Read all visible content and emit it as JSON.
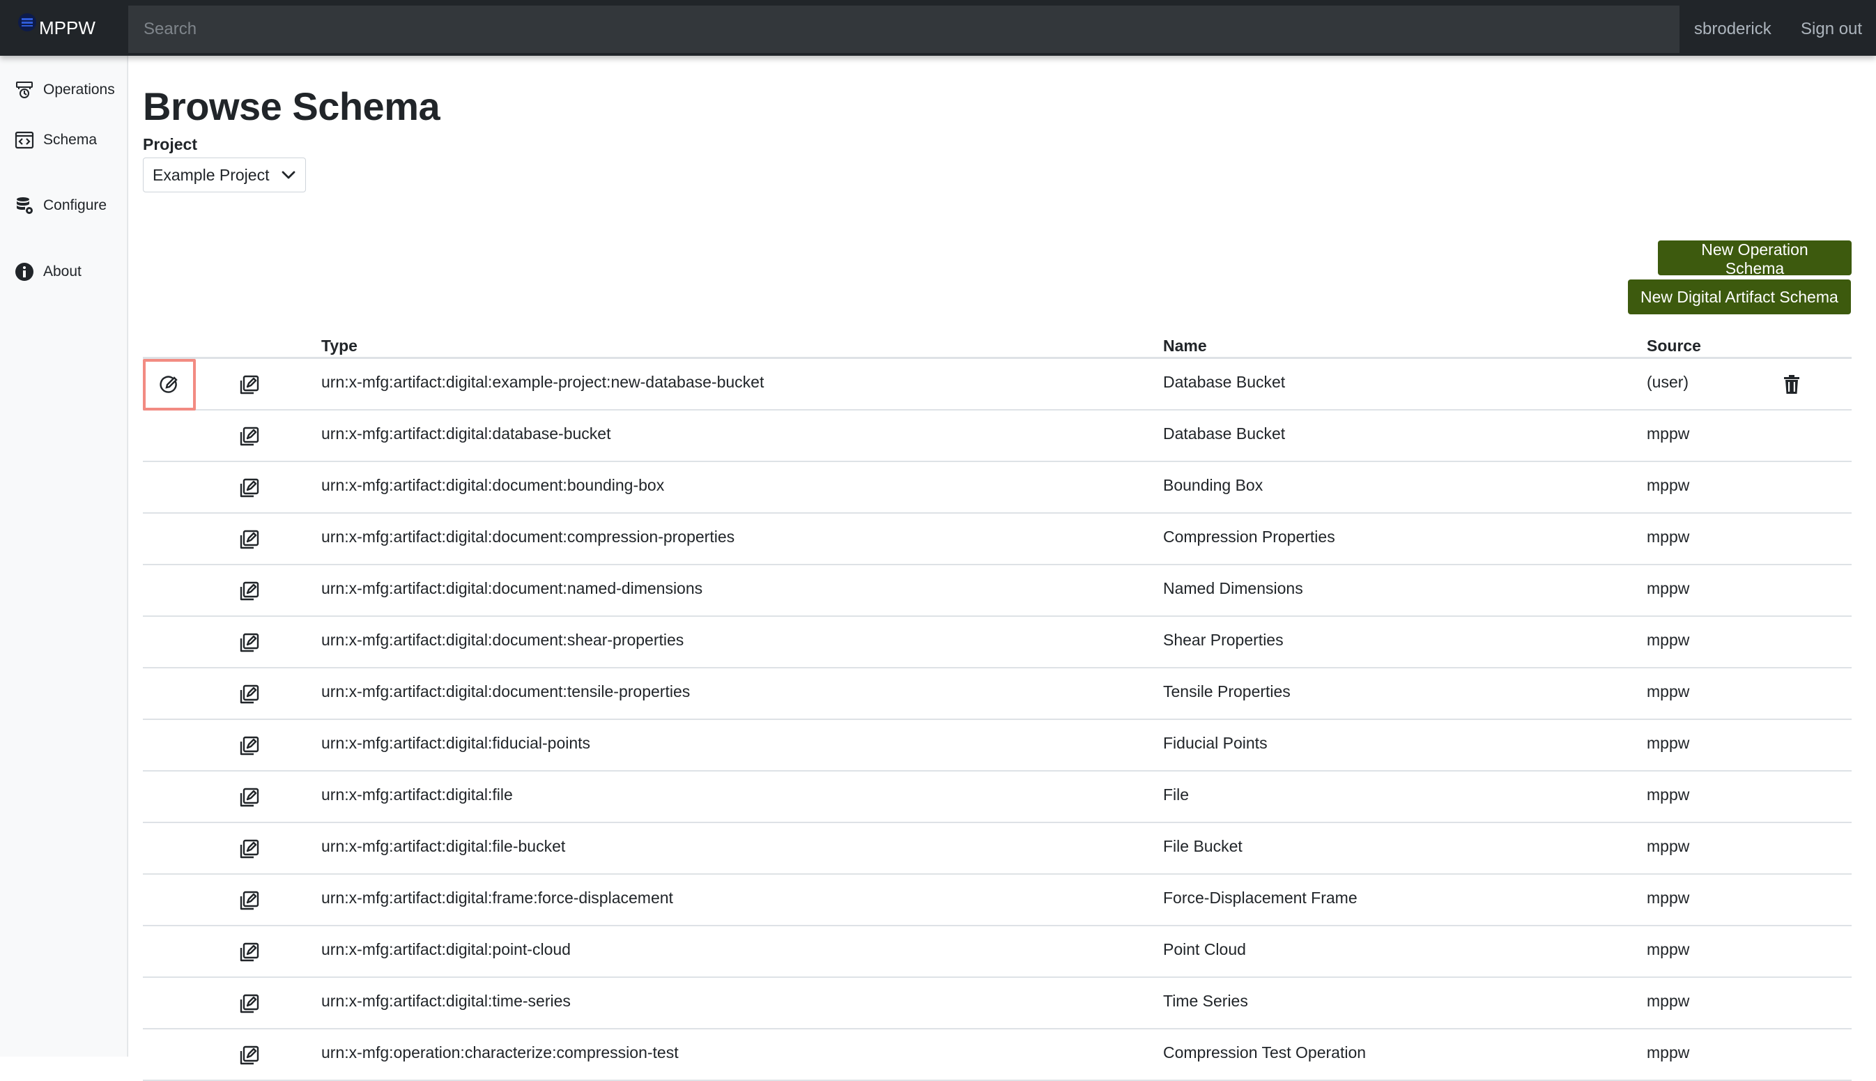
{
  "navbar": {
    "brand": "MPPW",
    "search_placeholder": "Search",
    "username": "sbroderick",
    "signout": "Sign out"
  },
  "sidebar": {
    "items": [
      {
        "label": "Operations",
        "icon": "operations-icon"
      },
      {
        "label": "Schema",
        "icon": "schema-icon"
      },
      {
        "label": "Configure",
        "icon": "configure-icon"
      },
      {
        "label": "About",
        "icon": "info-icon"
      }
    ]
  },
  "main": {
    "title": "Browse Schema",
    "project_label": "Project",
    "project_value": "Example Project",
    "new_operation_button": "New Operation Schema",
    "new_artifact_button": "New Digital Artifact Schema"
  },
  "table": {
    "headers": {
      "type": "Type",
      "name": "Name",
      "source": "Source"
    },
    "rows": [
      {
        "type": "urn:x-mfg:artifact:digital:example-project:new-database-bucket",
        "name": "Database Bucket",
        "source": "(user)",
        "editable": true
      },
      {
        "type": "urn:x-mfg:artifact:digital:database-bucket",
        "name": "Database Bucket",
        "source": "mppw"
      },
      {
        "type": "urn:x-mfg:artifact:digital:document:bounding-box",
        "name": "Bounding Box",
        "source": "mppw"
      },
      {
        "type": "urn:x-mfg:artifact:digital:document:compression-properties",
        "name": "Compression Properties",
        "source": "mppw"
      },
      {
        "type": "urn:x-mfg:artifact:digital:document:named-dimensions",
        "name": "Named Dimensions",
        "source": "mppw"
      },
      {
        "type": "urn:x-mfg:artifact:digital:document:shear-properties",
        "name": "Shear Properties",
        "source": "mppw"
      },
      {
        "type": "urn:x-mfg:artifact:digital:document:tensile-properties",
        "name": "Tensile Properties",
        "source": "mppw"
      },
      {
        "type": "urn:x-mfg:artifact:digital:fiducial-points",
        "name": "Fiducial Points",
        "source": "mppw"
      },
      {
        "type": "urn:x-mfg:artifact:digital:file",
        "name": "File",
        "source": "mppw"
      },
      {
        "type": "urn:x-mfg:artifact:digital:file-bucket",
        "name": "File Bucket",
        "source": "mppw"
      },
      {
        "type": "urn:x-mfg:artifact:digital:frame:force-displacement",
        "name": "Force-Displacement Frame",
        "source": "mppw"
      },
      {
        "type": "urn:x-mfg:artifact:digital:point-cloud",
        "name": "Point Cloud",
        "source": "mppw"
      },
      {
        "type": "urn:x-mfg:artifact:digital:time-series",
        "name": "Time Series",
        "source": "mppw"
      },
      {
        "type": "urn:x-mfg:operation:characterize:compression-test",
        "name": "Compression Test Operation",
        "source": "mppw"
      }
    ]
  }
}
